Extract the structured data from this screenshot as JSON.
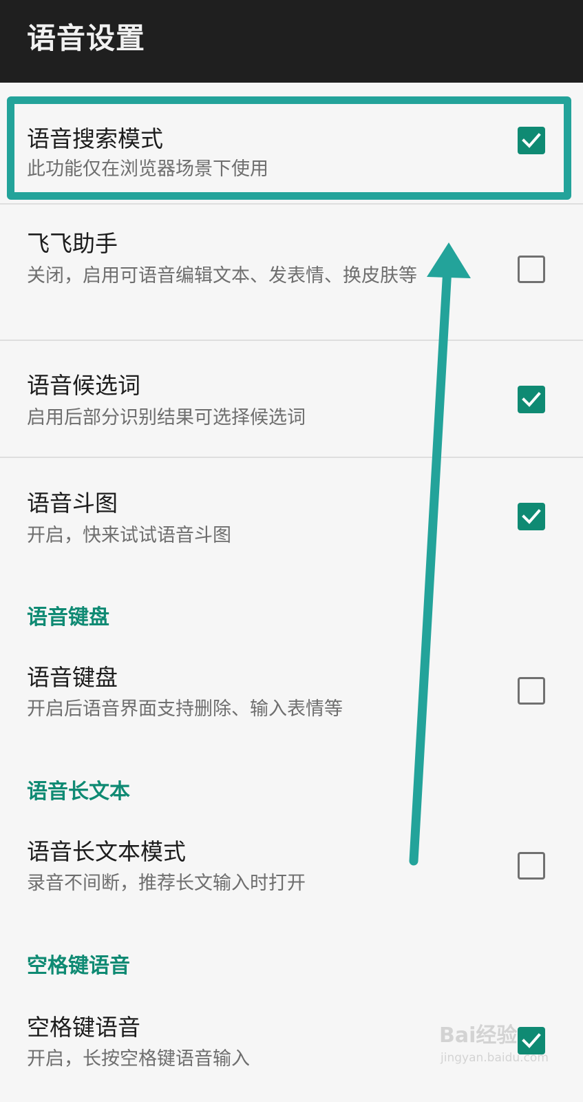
{
  "header": {
    "title": "语音设置"
  },
  "items": [
    {
      "title": "语音搜索模式",
      "subtitle": "此功能仅在浏览器场景下使用",
      "checked": true
    },
    {
      "title": "飞飞助手",
      "subtitle": "关闭，启用可语音编辑文本、发表情、换皮肤等",
      "checked": false
    },
    {
      "title": "语音候选词",
      "subtitle": "启用后部分识别结果可选择候选词",
      "checked": true
    },
    {
      "title": "语音斗图",
      "subtitle": "开启，快来试试语音斗图",
      "checked": true
    },
    {
      "title": "语音键盘",
      "subtitle": "开启后语音界面支持删除、输入表情等",
      "checked": false
    },
    {
      "title": "语音长文本模式",
      "subtitle": "录音不间断，推荐长文输入时打开",
      "checked": false
    },
    {
      "title": "空格键语音",
      "subtitle": "开启，长按空格键语音输入",
      "checked": true
    }
  ],
  "sections": [
    {
      "label": "语音键盘"
    },
    {
      "label": "语音长文本"
    },
    {
      "label": "空格键语音"
    }
  ],
  "annotation": {
    "color": "#23a39a",
    "target": "语音搜索模式"
  },
  "watermark": {
    "main": "Bai经验",
    "sub": "jingyan.baidu.com"
  },
  "colors": {
    "accent": "#0f8a73",
    "appbar": "#1f1f1f",
    "background": "#f6f6f6"
  },
  "icons": {
    "checked": "check-icon"
  }
}
